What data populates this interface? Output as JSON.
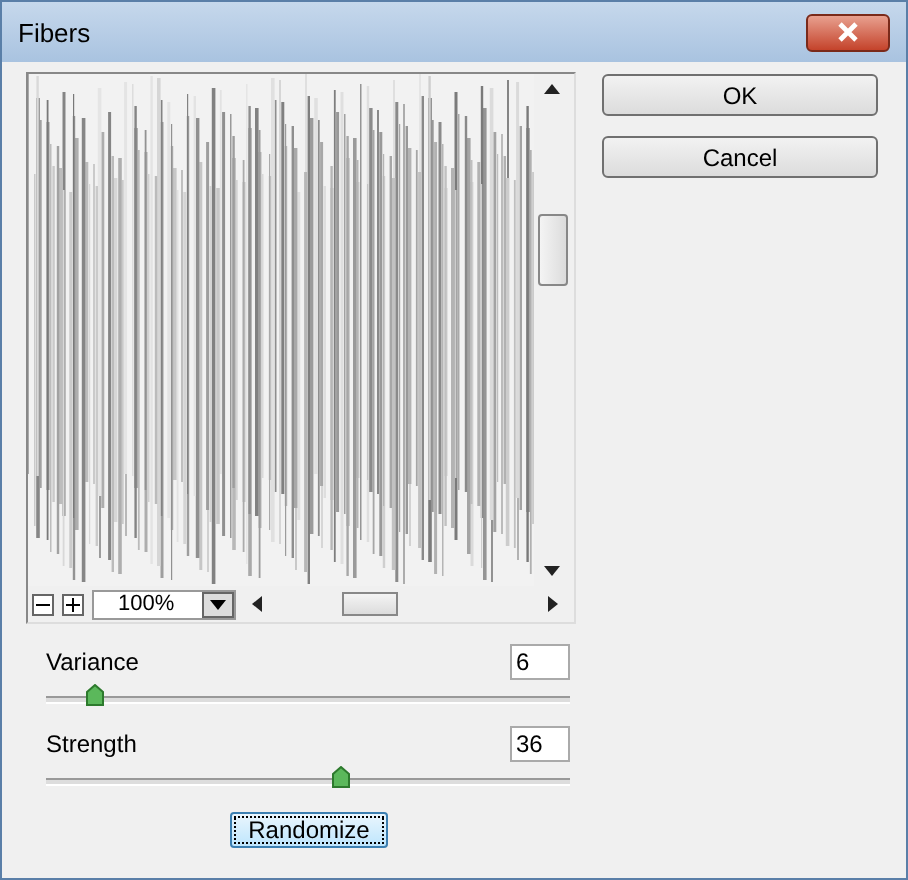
{
  "window": {
    "title": "Fibers"
  },
  "preview": {
    "zoom": "100%"
  },
  "buttons": [
    {
      "label": "OK"
    },
    {
      "label": "Cancel"
    }
  ],
  "sliders": [
    {
      "label": "Variance",
      "value": "6",
      "level": 0.09
    },
    {
      "label": "Strength",
      "value": "36",
      "level": 0.56
    }
  ],
  "randomize": {
    "label": "Randomize"
  }
}
